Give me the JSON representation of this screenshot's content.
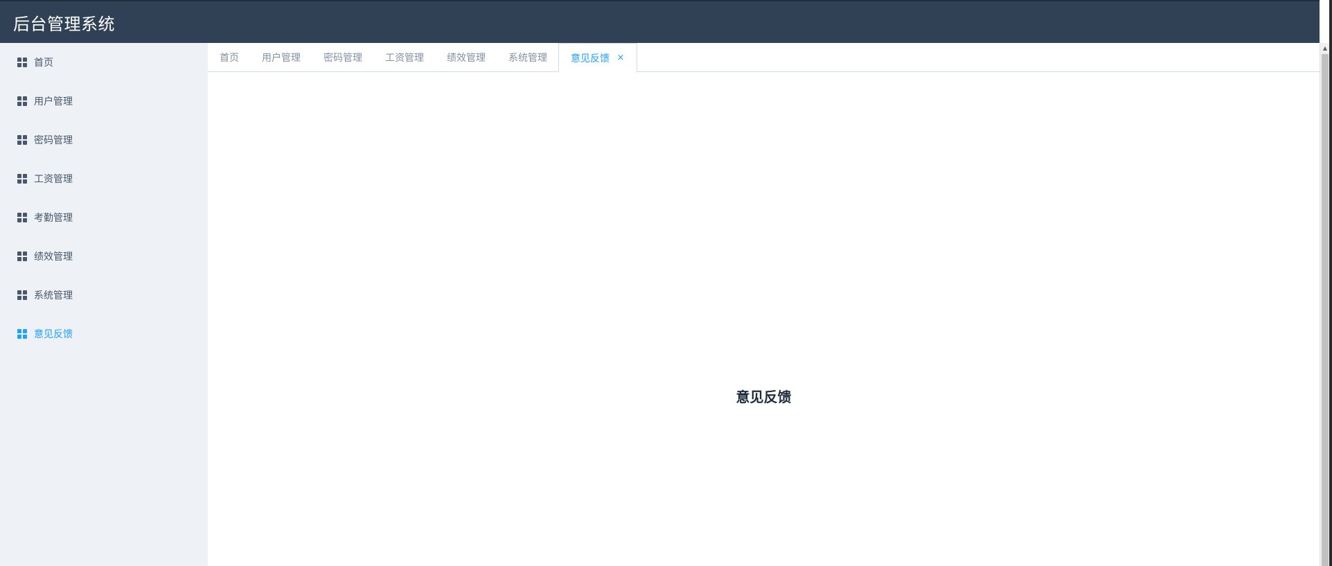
{
  "app": {
    "title": "后台管理系统"
  },
  "sidebar": {
    "items": [
      {
        "label": "首页",
        "icon": "grid-icon",
        "active": false
      },
      {
        "label": "用户管理",
        "icon": "grid-icon",
        "active": false
      },
      {
        "label": "密码管理",
        "icon": "grid-icon",
        "active": false
      },
      {
        "label": "工资管理",
        "icon": "grid-icon",
        "active": false
      },
      {
        "label": "考勤管理",
        "icon": "grid-icon",
        "active": false
      },
      {
        "label": "绩效管理",
        "icon": "grid-icon",
        "active": false
      },
      {
        "label": "系统管理",
        "icon": "grid-icon",
        "active": false
      },
      {
        "label": "意见反馈",
        "icon": "grid-icon",
        "active": true
      }
    ]
  },
  "tabs": [
    {
      "label": "首页",
      "active": false
    },
    {
      "label": "用户管理",
      "active": false
    },
    {
      "label": "密码管理",
      "active": false
    },
    {
      "label": "工资管理",
      "active": false
    },
    {
      "label": "绩效管理",
      "active": false
    },
    {
      "label": "系统管理",
      "active": false
    },
    {
      "label": "意见反馈",
      "active": true,
      "closable": true,
      "close_icon": "×"
    }
  ],
  "main": {
    "title": "意见反馈"
  },
  "colors": {
    "header_bg": "#304156",
    "sidebar_bg": "#eef1f6",
    "accent": "#20a0ff",
    "text": "#48576a",
    "tab_text": "#8391a5"
  }
}
